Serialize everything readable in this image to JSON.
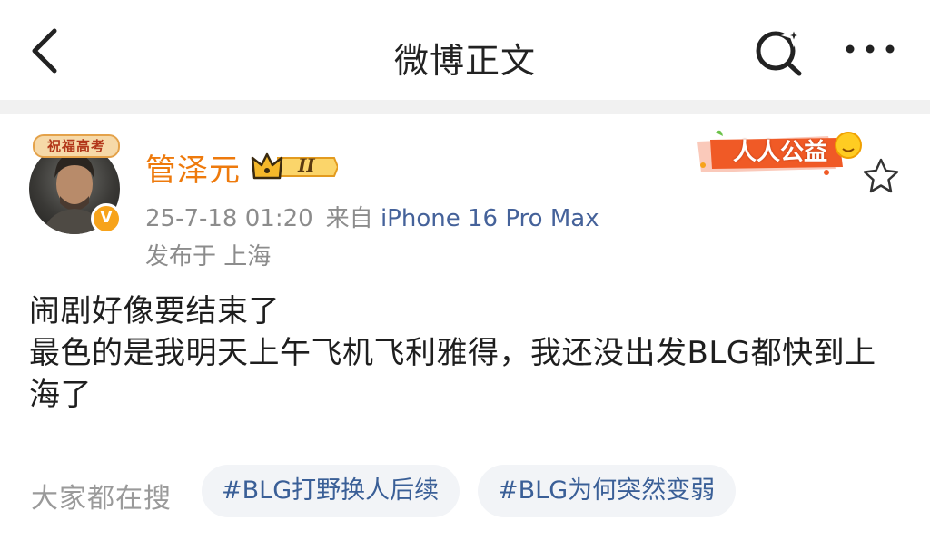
{
  "header": {
    "title": "微博正文",
    "back_icon": "chevron-left-icon",
    "search_icon": "search-sparkle-icon",
    "more_icon": "ellipsis-icon"
  },
  "post": {
    "author": {
      "name": "管泽元",
      "name_color": "#ee7a0c",
      "avatar_banner": "祝福高考",
      "verified_badge": "V",
      "vip_level": "II"
    },
    "charity_badge": "人人公益",
    "timestamp": "25-7-18 01:20",
    "source_prefix": "来自",
    "device": "iPhone 16 Pro Max",
    "location": "发布于 上海",
    "content_lines": [
      "闹剧好像要结束了",
      "最色的是我明天上午飞机飞利雅得，我还没出发BLG都快到上",
      "海了"
    ]
  },
  "trending": {
    "label": "大家都在搜",
    "topics": [
      "#BLG打野换人后续",
      "#BLG为何突然变弱"
    ]
  },
  "colors": {
    "accent_orange": "#ee7a0c",
    "link_blue": "#45629a",
    "topic_blue": "#3a5f97",
    "divider": "#f1f1f1"
  }
}
